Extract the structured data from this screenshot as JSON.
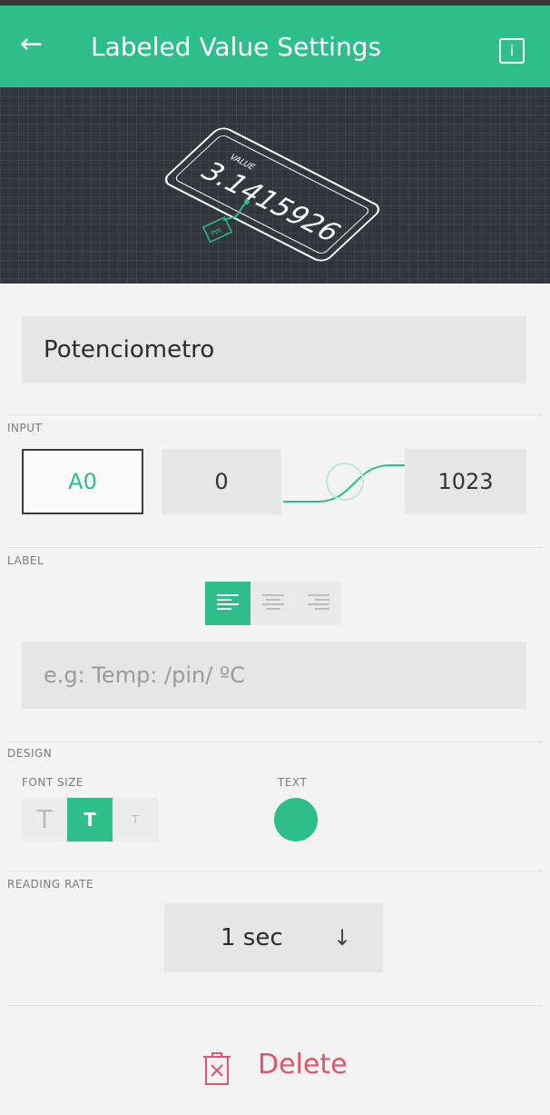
{
  "header": {
    "title": "Labeled Value Settings",
    "back_icon": "arrow-left-icon",
    "info_icon": "info-icon",
    "info_glyph": "i"
  },
  "preview": {
    "label": "VALUE",
    "value": "3.1415926",
    "pin_text": "PIN"
  },
  "name_field": {
    "value": "Potenciometro"
  },
  "input": {
    "section": "INPUT",
    "pin": "A0",
    "min": "0",
    "max": "1023"
  },
  "label": {
    "section": "LABEL",
    "placeholder": "e.g: Temp: /pin/ ºC",
    "alignment": "left"
  },
  "design": {
    "section": "DESIGN",
    "font_size_label": "FONT SIZE",
    "text_label": "TEXT",
    "font_sizes": [
      "T",
      "T",
      "T"
    ],
    "selected_font_size": 1,
    "text_color": "#2dbe8c"
  },
  "reading_rate": {
    "section": "READING RATE",
    "value": "1 sec",
    "arrow": "↓"
  },
  "delete": {
    "label": "Delete"
  },
  "colors": {
    "accent": "#2dbe8c",
    "danger": "#e0566f",
    "header_bg": "#2dbe8c"
  }
}
